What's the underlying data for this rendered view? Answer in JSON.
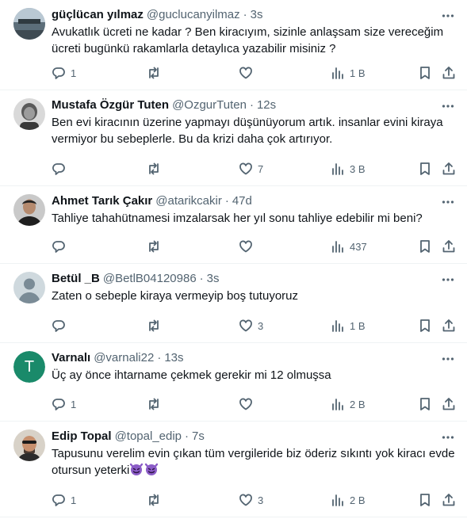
{
  "tweets": [
    {
      "name": "güçlücan yılmaz",
      "handle": "@guclucanyilmaz",
      "time": "3s",
      "text": "Avukatlık ücreti ne kadar ? Ben kiracıyım, sizinle anlaşsam size vereceğim ücreti bugünkü rakamlarla detaylıca yazabilir misiniz ?",
      "replies": "1",
      "retweets": "",
      "likes": "",
      "views": "1 B"
    },
    {
      "name": "Mustafa Özgür Tuten",
      "handle": "@OzgurTuten",
      "time": "12s",
      "text": "Ben evi kiracının üzerine yapmayı düşünüyorum artık. insanlar evini kiraya vermiyor bu sebeplerle. Bu da krizi daha çok artırıyor.",
      "replies": "",
      "retweets": "",
      "likes": "7",
      "views": "3 B"
    },
    {
      "name": "Ahmet Tarık Çakır",
      "handle": "@atarikcakir",
      "time": "47d",
      "text": "Tahliye tahahütnamesi imzalarsak her yıl sonu tahliye edebilir mi beni?",
      "replies": "",
      "retweets": "",
      "likes": "",
      "views": "437"
    },
    {
      "name": "Betül _B",
      "handle": "@BetlB04120986",
      "time": "3s",
      "text": "Zaten o sebeple kiraya vermeyip boş tutuyoruz",
      "replies": "",
      "retweets": "",
      "likes": "3",
      "views": "1 B"
    },
    {
      "name": "Varnalı",
      "handle": "@varnali22",
      "time": "13s",
      "avatar_letter": "T",
      "text": "Üç ay önce ihtarname çekmek gerekir mi 12 olmuşsa",
      "replies": "1",
      "retweets": "",
      "likes": "",
      "views": "2 B"
    },
    {
      "name": "Edip Topal",
      "handle": "@topal_edip",
      "time": "7s",
      "text": "Tapusunu verelim evin çıkan tüm vergileride biz öderiz sıkıntı yok kiracı evde otursun yeterki",
      "emojis": [
        "smiling-devil-emoji",
        "smiling-devil-emoji"
      ],
      "replies": "1",
      "retweets": "",
      "likes": "3",
      "views": "2 B"
    }
  ],
  "colors": {
    "text": "#0f1419",
    "secondary": "#536471",
    "divider": "#eff3f4",
    "avatar_letter_bg": "#1a8a6a",
    "emoji": "#8b5cc7"
  },
  "icons": [
    "more-icon",
    "reply-icon",
    "retweet-icon",
    "like-icon",
    "views-icon",
    "bookmark-icon",
    "share-icon"
  ]
}
